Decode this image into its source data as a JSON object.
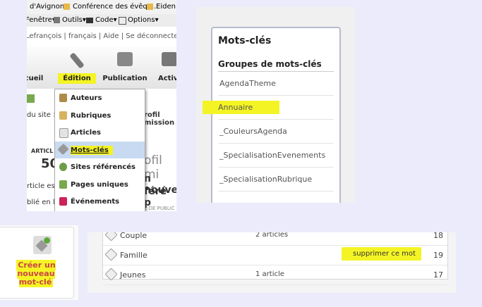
{
  "panel1": {
    "bookmarks": [
      "d'Avignon",
      "Conférence des évêqu...",
      "Eiden S"
    ],
    "toolbar": [
      "Fenêtre▾",
      "Outils▾",
      "Code▾",
      "Options▾"
    ],
    "userbar": "Lefrançois | français | Aide | Se déconnecter",
    "nav": [
      "cueil",
      "Édition",
      "Publication",
      "Activ"
    ],
    "bg_texts": [
      "du site >",
      "rofil mission",
      "ARTICL",
      "50",
      "ofil mi",
      "n nouve",
      "féré p",
      "rticle est",
      "blié en l",
      "E DE PUBLIC"
    ],
    "menu_items": [
      "Auteurs",
      "Rubriques",
      "Articles",
      "Mots-clés",
      "Sites référencés",
      "Pages uniques",
      "Événements"
    ]
  },
  "panel2": {
    "title": "Mots-clés",
    "subtitle": "Groupes de mots-clés",
    "groups": [
      "AgendaTheme",
      "Annuaire",
      "_CouleursAgenda",
      "_SpecialisationEvenements",
      "_SpecialisationRubrique"
    ]
  },
  "panel3": {
    "button_label": "Créer un nouveau mot-clé"
  },
  "panel4": {
    "rows": [
      {
        "name": "Couple",
        "articles": "2 articles",
        "count": "18"
      },
      {
        "name": "Famille",
        "articles": "",
        "action": "supprimer ce mot",
        "count": "19"
      },
      {
        "name": "Jeunes",
        "articles": "1 article",
        "count": "17"
      }
    ]
  }
}
